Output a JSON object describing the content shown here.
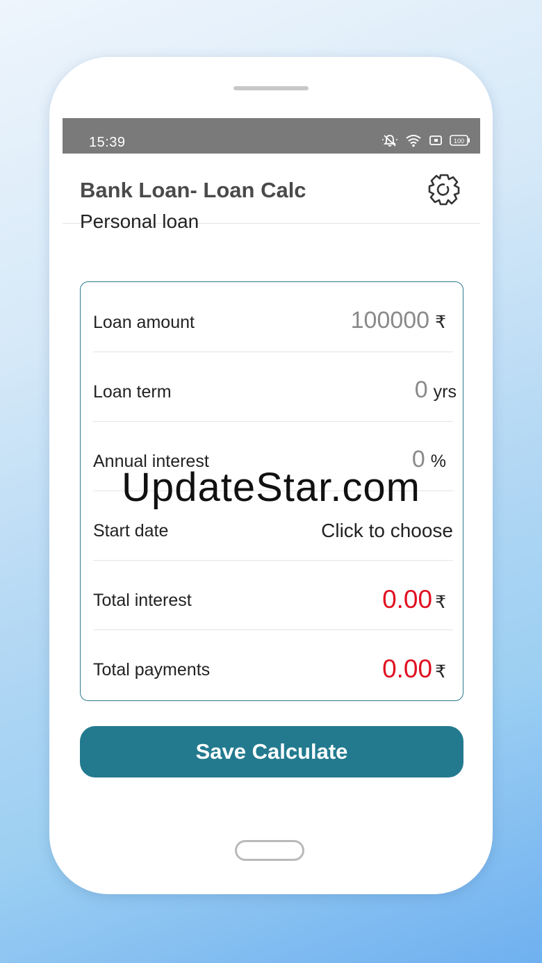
{
  "status_bar": {
    "time": "15:39",
    "battery": "100"
  },
  "app_bar": {
    "title": "Bank Loan- Loan Calc",
    "settings_icon": "gear-icon"
  },
  "section": {
    "title": "Personal loan"
  },
  "form": {
    "loan_amount": {
      "label": "Loan amount",
      "value": "100000",
      "unit": "₹"
    },
    "loan_term": {
      "label": "Loan term",
      "value": "0",
      "unit": "yrs"
    },
    "annual_interest": {
      "label": "Annual interest",
      "value": "0",
      "unit": "%"
    },
    "start_date": {
      "label": "Start date",
      "value": "Click to choose"
    },
    "total_interest": {
      "label": "Total interest",
      "value": "0.00",
      "unit": "₹"
    },
    "total_payments": {
      "label": "Total payments",
      "value": "0.00",
      "unit": "₹"
    }
  },
  "actions": {
    "save_label": "Save Calculate"
  },
  "watermark": "UpdateStar.com",
  "colors": {
    "accent": "#237a8f",
    "result_red": "#e01020",
    "status_bar": "#7a7a7a"
  }
}
